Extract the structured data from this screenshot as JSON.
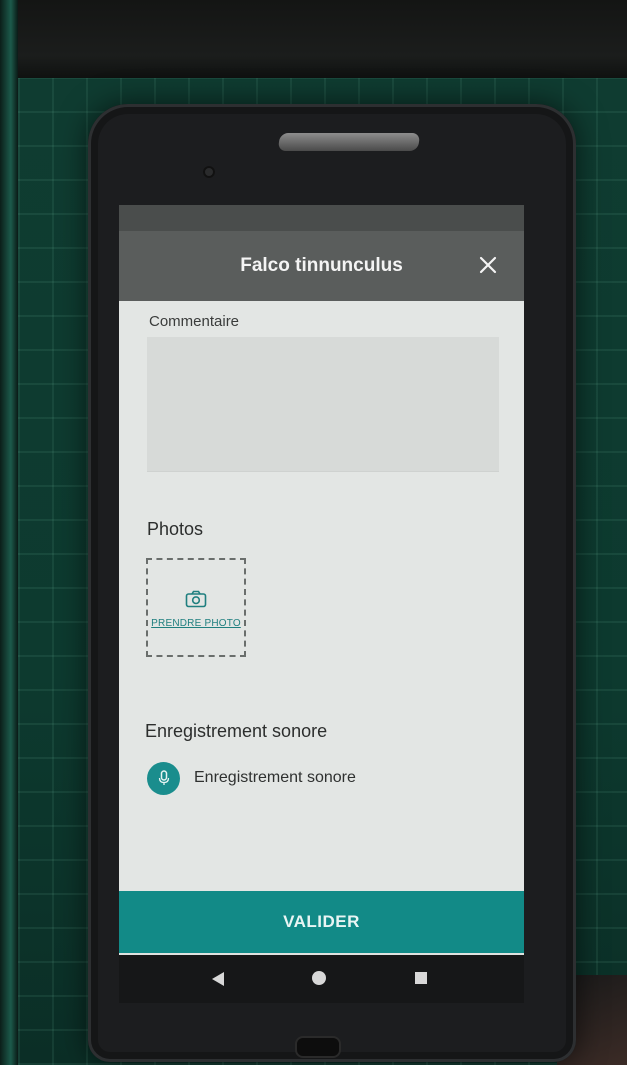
{
  "app": {
    "header_title": "Falco tinnunculus",
    "close_icon": "close-icon"
  },
  "form": {
    "comment_label": "Commentaire",
    "comment_value": "",
    "photos_title": "Photos",
    "photo_add_label": "PRENDRE PHOTO",
    "recording_title": "Enregistrement sonore",
    "recording_item_label": "Enregistrement sonore"
  },
  "actions": {
    "validate_label": "VALIDER"
  },
  "colors": {
    "accent": "#128a87",
    "header": "#5a5d5c"
  }
}
